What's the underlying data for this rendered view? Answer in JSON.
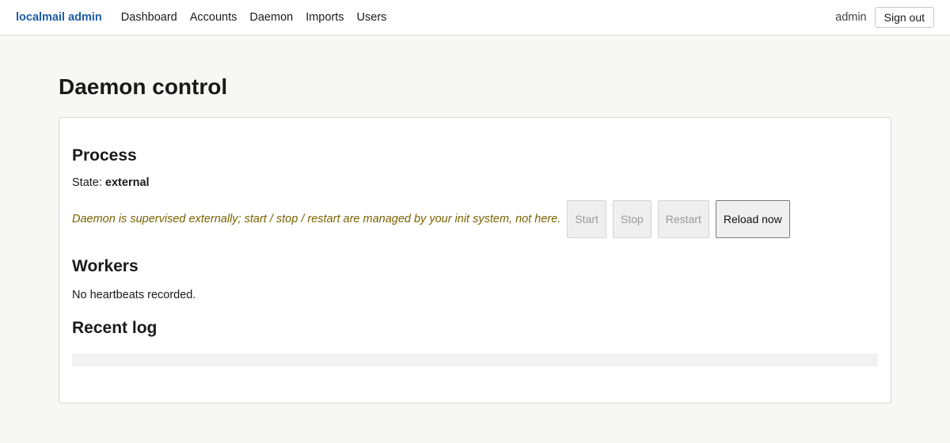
{
  "app": {
    "brand": "localmail admin"
  },
  "nav": {
    "items": [
      "Dashboard",
      "Accounts",
      "Daemon",
      "Imports",
      "Users"
    ]
  },
  "user": {
    "name": "admin",
    "signout_label": "Sign out"
  },
  "page": {
    "title": "Daemon control"
  },
  "process": {
    "heading": "Process",
    "state_label": "State:",
    "state_value": "external",
    "notice": "Daemon is supervised externally; start / stop / restart are managed by your init system, not here.",
    "buttons": {
      "start": "Start",
      "stop": "Stop",
      "restart": "Restart",
      "reload": "Reload now"
    }
  },
  "workers": {
    "heading": "Workers",
    "empty_text": "No heartbeats recorded."
  },
  "log": {
    "heading": "Recent log"
  },
  "colors": {
    "brand": "#1f5ea8",
    "notice": "#7a6200"
  }
}
